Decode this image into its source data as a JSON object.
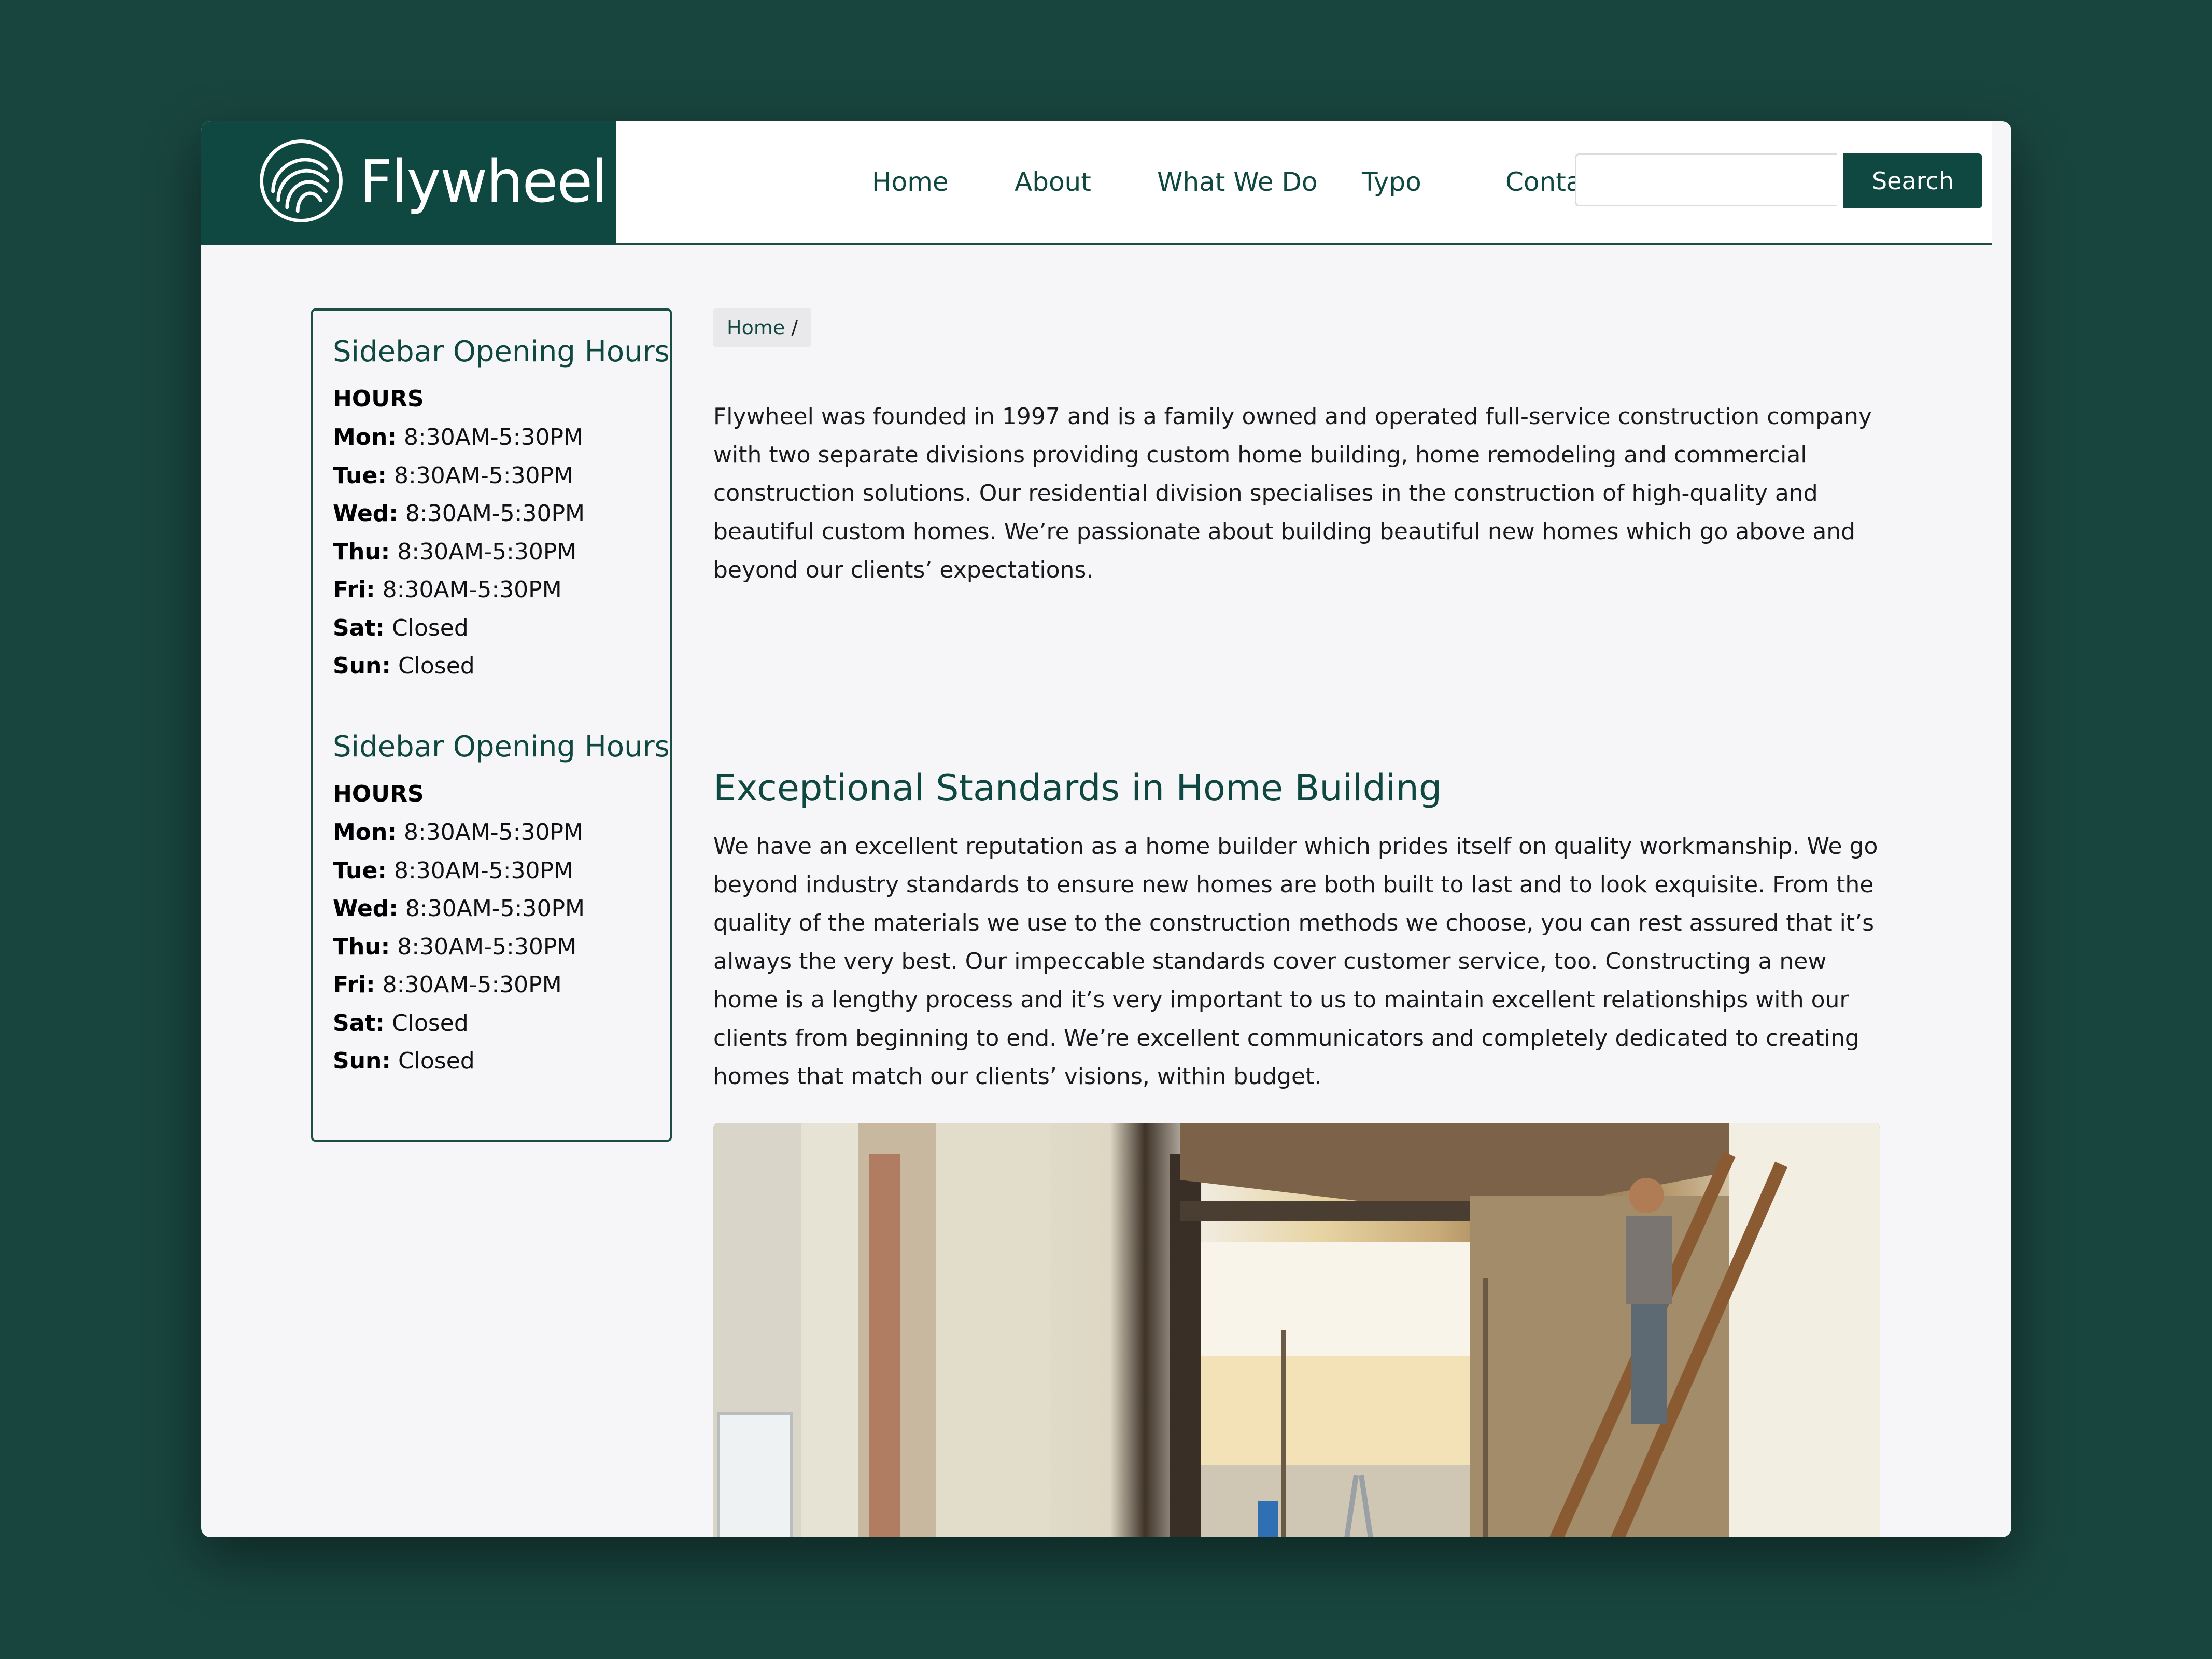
{
  "brand": {
    "name": "Flywheel",
    "logo_icon": "spiral-swirl-icon"
  },
  "nav": {
    "items": [
      {
        "label": "Home"
      },
      {
        "label": "About"
      },
      {
        "label": "What We Do"
      },
      {
        "label": "Typo"
      },
      {
        "label": "Contact"
      }
    ]
  },
  "search": {
    "value": "",
    "placeholder": "",
    "button_label": "Search"
  },
  "colors": {
    "brand_green": "#0e4840",
    "page_background": "#19453f",
    "content_background": "#f6f6f8"
  },
  "sidebar": {
    "widgets": [
      {
        "title": "Sidebar Opening Hours",
        "heading": "HOURS",
        "rows": [
          {
            "day": "Mon:",
            "time": "8:30AM-5:30PM"
          },
          {
            "day": "Tue:",
            "time": "8:30AM-5:30PM"
          },
          {
            "day": "Wed:",
            "time": "8:30AM-5:30PM"
          },
          {
            "day": "Thu:",
            "time": "8:30AM-5:30PM"
          },
          {
            "day": "Fri:",
            "time": "8:30AM-5:30PM"
          },
          {
            "day": "Sat:",
            "time": "Closed"
          },
          {
            "day": "Sun:",
            "time": "Closed"
          }
        ]
      },
      {
        "title": "Sidebar Opening Hours",
        "heading": "HOURS",
        "rows": [
          {
            "day": "Mon:",
            "time": "8:30AM-5:30PM"
          },
          {
            "day": "Tue:",
            "time": "8:30AM-5:30PM"
          },
          {
            "day": "Wed:",
            "time": "8:30AM-5:30PM"
          },
          {
            "day": "Thu:",
            "time": "8:30AM-5:30PM"
          },
          {
            "day": "Fri:",
            "time": "8:30AM-5:30PM"
          },
          {
            "day": "Sat:",
            "time": "Closed"
          },
          {
            "day": "Sun:",
            "time": "Closed"
          }
        ]
      }
    ]
  },
  "main": {
    "breadcrumb": {
      "home": "Home",
      "separator": "/"
    },
    "intro": "Flywheel was founded in 1997 and is a family owned and operated full-service construction company with two separate divisions providing custom home building, home remodeling and commercial construction solutions. Our residential division specialises in the construction of high-quality and beautiful custom homes. We’re passionate about building beautiful new homes which go above and beyond our clients’ expectations.",
    "section_title": "Exceptional Standards in Home Building",
    "section_body": "We have an excellent reputation as a home builder which prides itself on quality workmanship. We go beyond industry standards to ensure new homes are both built to last and to look exquisite. From the quality of the materials we use to the construction methods we choose, you can rest assured that it’s always the very best. Our impeccable standards cover customer service, too. Constructing a new home is a lengthy process and it’s very important to us to maintain excellent relationships with our clients from beginning to end. We’re excellent communicators and completely dedicated to creating homes that match our clients’ visions, within budget."
  }
}
